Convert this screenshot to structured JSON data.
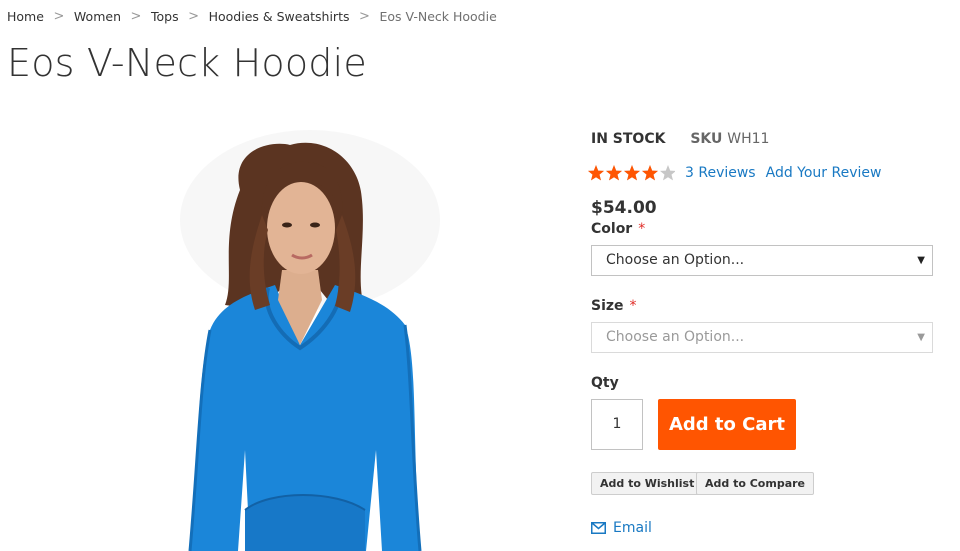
{
  "breadcrumbs": [
    {
      "label": "Home"
    },
    {
      "label": "Women"
    },
    {
      "label": "Tops"
    },
    {
      "label": "Hoodies & Sweatshirts"
    },
    {
      "label": "Eos V-Neck Hoodie"
    }
  ],
  "breadcrumb_separator": ">",
  "product": {
    "title": "Eos V-Neck Hoodie",
    "stock": "IN STOCK",
    "sku_label": "SKU",
    "sku": "WH11",
    "rating": 0.8,
    "reviews_label": "3 Reviews",
    "add_review_label": "Add Your Review",
    "price": "$54.00",
    "image_alt": "Woman wearing a blue v-neck hoodie"
  },
  "options": {
    "color_label": "Color",
    "color_placeholder": "Choose an Option...",
    "size_label": "Size",
    "size_placeholder": "Choose an Option...",
    "required_mark": "*"
  },
  "qty": {
    "label": "Qty",
    "value": "1"
  },
  "actions": {
    "add_to_cart": "Add to Cart",
    "add_to_wishlist": "Add to Wishlist",
    "add_to_compare": "Add to Compare",
    "email": "Email"
  },
  "colors": {
    "accent_orange": "#ff5501",
    "link_blue": "#1979c3",
    "star_orange": "#ff5501",
    "star_empty": "#c7c7c7",
    "required_red": "#e02b27"
  },
  "icons": {
    "star": "star-icon",
    "dropdown": "chevron-down-icon",
    "email": "envelope-icon"
  }
}
